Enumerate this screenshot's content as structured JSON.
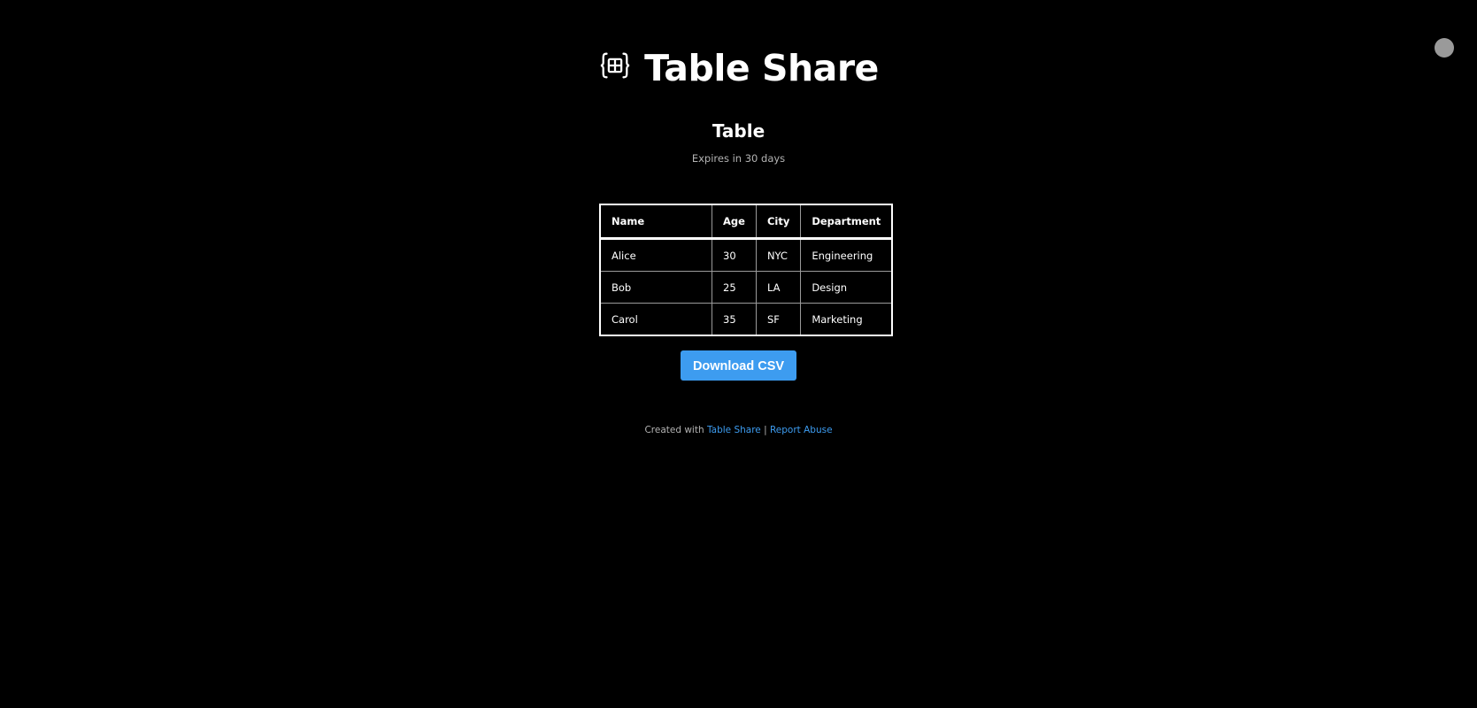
{
  "header": {
    "logo_icon": "table-braces-icon",
    "title": "Table Share"
  },
  "theme_toggle": {
    "icon": "circle-toggle-icon",
    "color": "#9a9a9a"
  },
  "page": {
    "heading": "Table",
    "expires": "Expires in 30 days"
  },
  "table": {
    "headers": [
      "Name",
      "Age",
      "City",
      "Department"
    ],
    "rows": [
      [
        "Alice",
        "30",
        "NYC",
        "Engineering"
      ],
      [
        "Bob",
        "25",
        "LA",
        "Design"
      ],
      [
        "Carol",
        "35",
        "SF",
        "Marketing"
      ]
    ]
  },
  "actions": {
    "download_label": "Download CSV"
  },
  "footer": {
    "created_with": "Created with",
    "app_link": "Table Share",
    "separator": "|",
    "report_link": "Report Abuse"
  },
  "colors": {
    "background": "#000000",
    "accent": "#3d9cf0",
    "muted_text": "#b3b3b3"
  }
}
